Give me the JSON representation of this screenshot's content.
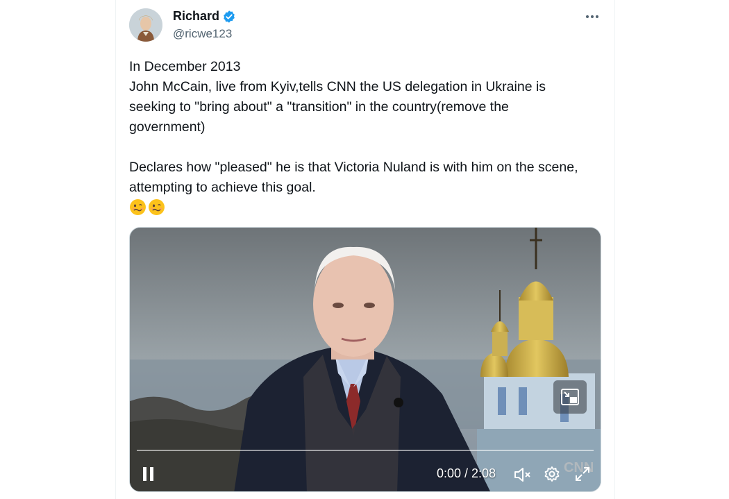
{
  "author": {
    "display_name": "Richard",
    "handle": "@ricwe123",
    "verified": true,
    "verified_color": "#1d9bf0"
  },
  "tweet": {
    "text": "In December 2013\nJohn McCain, live from Kyiv,tells CNN the US delegation in Ukraine is seeking to \"bring about\" a \"transition\" in the country(remove the government)\n\nDeclares how \"pleased\" he is that Victoria Nuland is with him on the scene, attempting to achieve this goal.",
    "emojis": [
      "woozy-face-emoji",
      "woozy-face-emoji"
    ]
  },
  "video": {
    "time_display": "0:00 / 2:08",
    "progress_fraction": 0.0,
    "state": "playing",
    "muted": true,
    "icons": [
      "pause-icon",
      "mute-icon",
      "settings-gear-icon",
      "fullscreen-icon",
      "picture-in-picture-icon"
    ]
  },
  "colors": {
    "text_primary": "#0f1419",
    "text_secondary": "#536471",
    "accent": "#1d9bf0"
  }
}
